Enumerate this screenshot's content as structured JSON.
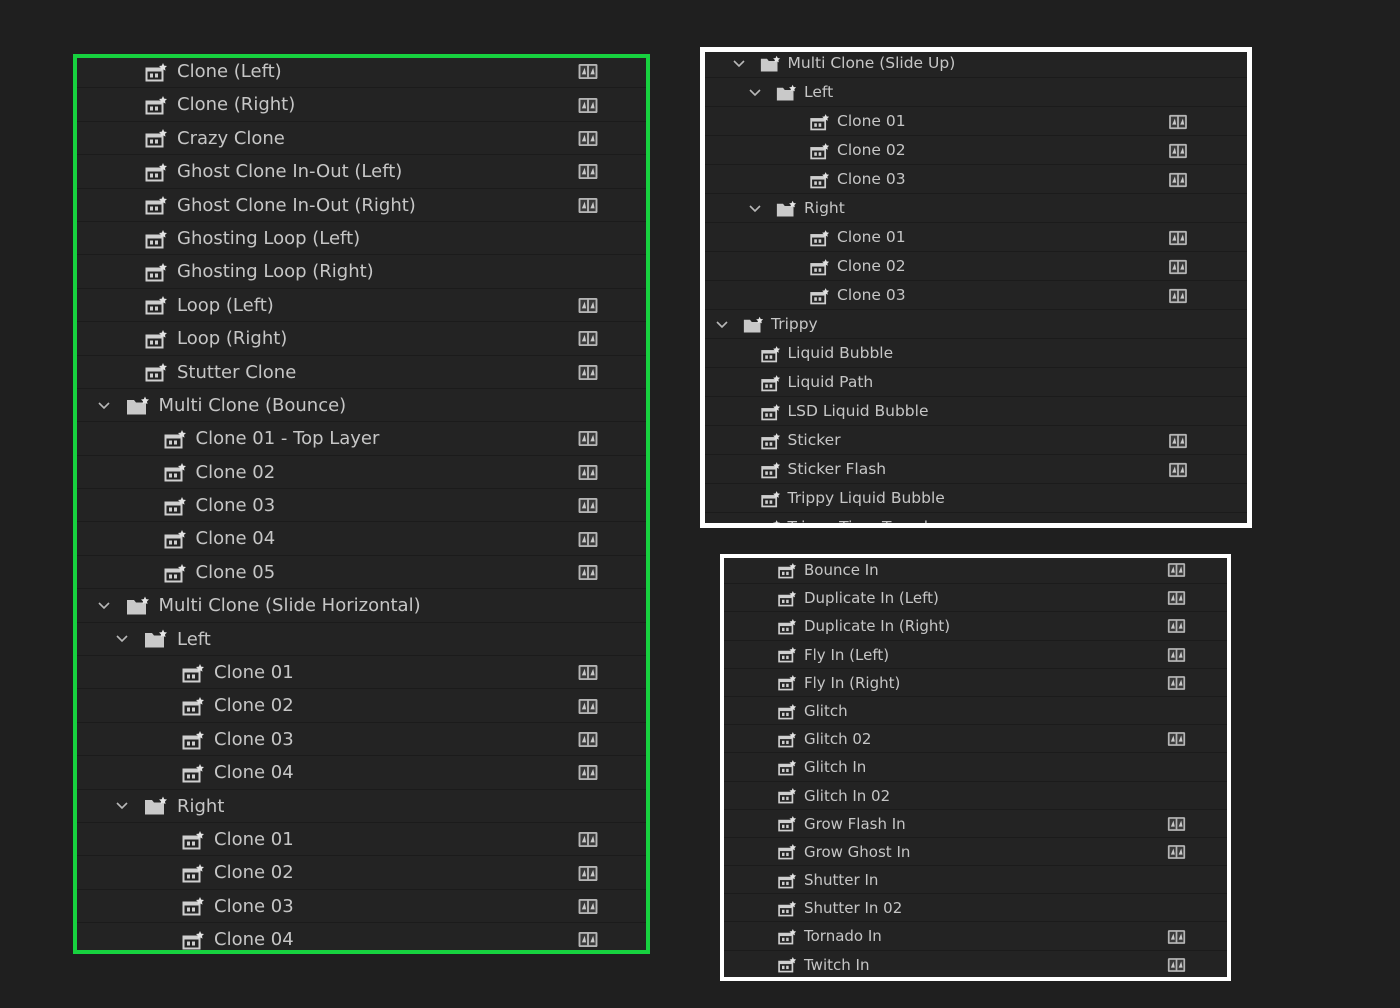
{
  "colors": {
    "background": "#1f1f1f",
    "panel": "#232323",
    "highlight_green": "#17d13f",
    "highlight_white": "#ffffff",
    "text": "#c6c6c6"
  },
  "panels": [
    {
      "id": "panel-green",
      "rows": [
        {
          "label": "Clone (Left)",
          "type": "preset",
          "level": 2,
          "badge": true
        },
        {
          "label": "Clone (Right)",
          "type": "preset",
          "level": 2,
          "badge": true
        },
        {
          "label": "Crazy Clone",
          "type": "preset",
          "level": 2,
          "badge": true
        },
        {
          "label": "Ghost Clone In-Out (Left)",
          "type": "preset",
          "level": 2,
          "badge": true
        },
        {
          "label": "Ghost Clone In-Out (Right)",
          "type": "preset",
          "level": 2,
          "badge": true
        },
        {
          "label": "Ghosting Loop (Left)",
          "type": "preset",
          "level": 2,
          "badge": false
        },
        {
          "label": "Ghosting Loop (Right)",
          "type": "preset",
          "level": 2,
          "badge": false
        },
        {
          "label": "Loop (Left)",
          "type": "preset",
          "level": 2,
          "badge": true
        },
        {
          "label": "Loop (Right)",
          "type": "preset",
          "level": 2,
          "badge": true
        },
        {
          "label": "Stutter Clone",
          "type": "preset",
          "level": 2,
          "badge": true
        },
        {
          "label": "Multi Clone (Bounce)",
          "type": "folder",
          "level": 1,
          "badge": false
        },
        {
          "label": "Clone 01 - Top Layer",
          "type": "preset",
          "level": 3,
          "badge": true
        },
        {
          "label": "Clone 02",
          "type": "preset",
          "level": 3,
          "badge": true
        },
        {
          "label": "Clone 03",
          "type": "preset",
          "level": 3,
          "badge": true
        },
        {
          "label": "Clone 04",
          "type": "preset",
          "level": 3,
          "badge": true
        },
        {
          "label": "Clone 05",
          "type": "preset",
          "level": 3,
          "badge": true
        },
        {
          "label": "Multi Clone (Slide Horizontal)",
          "type": "folder",
          "level": 1,
          "badge": false
        },
        {
          "label": "Left",
          "type": "folder",
          "level": 2,
          "badge": false
        },
        {
          "label": "Clone 01",
          "type": "preset",
          "level": 4,
          "badge": true
        },
        {
          "label": "Clone 02",
          "type": "preset",
          "level": 4,
          "badge": true
        },
        {
          "label": "Clone 03",
          "type": "preset",
          "level": 4,
          "badge": true
        },
        {
          "label": "Clone 04",
          "type": "preset",
          "level": 4,
          "badge": true
        },
        {
          "label": "Right",
          "type": "folder",
          "level": 2,
          "badge": false
        },
        {
          "label": "Clone 01",
          "type": "preset",
          "level": 4,
          "badge": true
        },
        {
          "label": "Clone 02",
          "type": "preset",
          "level": 4,
          "badge": true
        },
        {
          "label": "Clone 03",
          "type": "preset",
          "level": 4,
          "badge": true
        },
        {
          "label": "Clone 04",
          "type": "preset",
          "level": 4,
          "badge": true
        }
      ]
    },
    {
      "id": "panel-topright",
      "rows": [
        {
          "label": "Multi Clone (Slide Up)",
          "type": "folder",
          "level": 1,
          "badge": false
        },
        {
          "label": "Left",
          "type": "folder",
          "level": 2,
          "badge": false
        },
        {
          "label": "Clone 01",
          "type": "preset",
          "level": 4,
          "badge": true
        },
        {
          "label": "Clone 02",
          "type": "preset",
          "level": 4,
          "badge": true
        },
        {
          "label": "Clone 03",
          "type": "preset",
          "level": 4,
          "badge": true
        },
        {
          "label": "Right",
          "type": "folder",
          "level": 2,
          "badge": false
        },
        {
          "label": "Clone 01",
          "type": "preset",
          "level": 4,
          "badge": true
        },
        {
          "label": "Clone 02",
          "type": "preset",
          "level": 4,
          "badge": true
        },
        {
          "label": "Clone 03",
          "type": "preset",
          "level": 4,
          "badge": true
        },
        {
          "label": "Trippy",
          "type": "folder",
          "level": 0,
          "badge": false
        },
        {
          "label": "Liquid Bubble",
          "type": "preset",
          "level": 1,
          "badge": false
        },
        {
          "label": "Liquid Path",
          "type": "preset",
          "level": 1,
          "badge": false
        },
        {
          "label": "LSD Liquid Bubble",
          "type": "preset",
          "level": 1,
          "badge": false
        },
        {
          "label": "Sticker",
          "type": "preset",
          "level": 1,
          "badge": true
        },
        {
          "label": "Sticker Flash",
          "type": "preset",
          "level": 1,
          "badge": true
        },
        {
          "label": "Trippy Liquid Bubble",
          "type": "preset",
          "level": 1,
          "badge": false
        },
        {
          "label": "Trippy Time Travel",
          "type": "preset",
          "level": 1,
          "badge": false
        }
      ]
    },
    {
      "id": "panel-bottomright",
      "rows": [
        {
          "label": "Bounce In",
          "type": "preset",
          "level": 0,
          "badge": true
        },
        {
          "label": "Duplicate In (Left)",
          "type": "preset",
          "level": 0,
          "badge": true
        },
        {
          "label": "Duplicate In (Right)",
          "type": "preset",
          "level": 0,
          "badge": true
        },
        {
          "label": "Fly In (Left)",
          "type": "preset",
          "level": 0,
          "badge": true
        },
        {
          "label": "Fly In (Right)",
          "type": "preset",
          "level": 0,
          "badge": true
        },
        {
          "label": "Glitch",
          "type": "preset",
          "level": 0,
          "badge": false
        },
        {
          "label": "Glitch 02",
          "type": "preset",
          "level": 0,
          "badge": true
        },
        {
          "label": "Glitch In",
          "type": "preset",
          "level": 0,
          "badge": false
        },
        {
          "label": "Glitch In 02",
          "type": "preset",
          "level": 0,
          "badge": false
        },
        {
          "label": "Grow Flash In",
          "type": "preset",
          "level": 0,
          "badge": true
        },
        {
          "label": "Grow Ghost In",
          "type": "preset",
          "level": 0,
          "badge": true
        },
        {
          "label": "Shutter In",
          "type": "preset",
          "level": 0,
          "badge": false
        },
        {
          "label": "Shutter In 02",
          "type": "preset",
          "level": 0,
          "badge": false
        },
        {
          "label": "Tornado In",
          "type": "preset",
          "level": 0,
          "badge": true
        },
        {
          "label": "Twitch In",
          "type": "preset",
          "level": 0,
          "badge": true
        }
      ]
    }
  ]
}
